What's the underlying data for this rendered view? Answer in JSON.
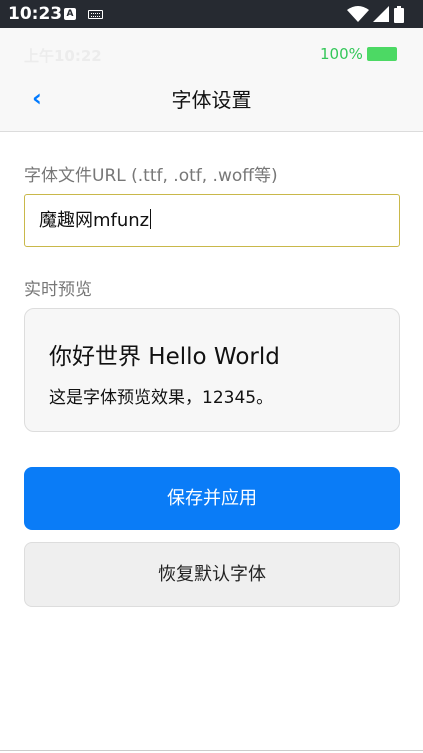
{
  "system_bar": {
    "time": "10:23",
    "notification_icon_a": "A"
  },
  "header": {
    "clock": "上午10:22",
    "battery_percent": "100%",
    "back_icon": "‹",
    "title": "字体设置"
  },
  "form": {
    "url_label": "字体文件URL (.ttf, .otf, .woff等)",
    "url_value": "魔趣网mfunz"
  },
  "preview": {
    "label": "实时预览",
    "title_text": "你好世界 Hello World",
    "body_text": "这是字体预览效果，12345。"
  },
  "buttons": {
    "save_label": "保存并应用",
    "reset_label": "恢复默认字体"
  },
  "colors": {
    "accent": "#007aff",
    "primary_button": "#0a7cf7",
    "battery": "#34c759",
    "input_border": "#c9b84a"
  },
  "icons": {
    "status_notification": "a-badge-icon",
    "keyboard": "keyboard-icon",
    "wifi": "wifi-icon",
    "signal": "cellular-signal-icon",
    "system_battery": "battery-icon",
    "back": "chevron-left-icon",
    "app_battery": "battery-full-icon"
  }
}
